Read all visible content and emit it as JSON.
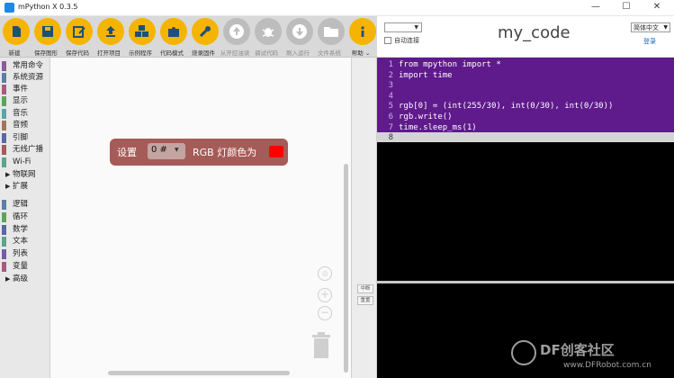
{
  "window": {
    "title": "mPython X 0.3.5",
    "controls": [
      "—",
      "☐",
      "✕"
    ]
  },
  "toolbar": {
    "items": [
      {
        "label": "新建",
        "icon": "new-file-icon",
        "active": true
      },
      {
        "label": "保存图形",
        "icon": "save-icon",
        "active": true
      },
      {
        "label": "保存代码",
        "icon": "edit-code-icon",
        "active": true
      },
      {
        "label": "打开项目",
        "icon": "upload-icon",
        "active": true
      },
      {
        "label": "示例程序",
        "icon": "cubes-icon",
        "active": true
      },
      {
        "label": "代码模式",
        "icon": "puzzle-icon",
        "active": true
      },
      {
        "label": "烧录固件",
        "icon": "wrench-icon",
        "active": true
      },
      {
        "label": "从开控油读",
        "icon": "upload-circle-icon",
        "active": false
      },
      {
        "label": "调试代码",
        "icon": "bug-icon",
        "active": false
      },
      {
        "label": "刷入运行",
        "icon": "download-circle-icon",
        "active": false
      },
      {
        "label": "文件系统",
        "icon": "folder-icon",
        "active": false
      },
      {
        "label": "帮助",
        "icon": "info-icon",
        "active": true
      }
    ],
    "help_suffix": "⌄"
  },
  "header": {
    "port_select_value": "",
    "auto_connect_label": "自动连接",
    "file_name": "my_code",
    "language": "简体中文",
    "login_label": "登录"
  },
  "categories": [
    {
      "label": "常用命令",
      "color": "#8e5a9e"
    },
    {
      "label": "系统资源",
      "color": "#5b80a5"
    },
    {
      "label": "事件",
      "color": "#a55b80"
    },
    {
      "label": "显示",
      "color": "#5ba55b"
    },
    {
      "label": "音乐",
      "color": "#5ba5a5"
    },
    {
      "label": "音频",
      "color": "#a5745b"
    },
    {
      "label": "引脚",
      "color": "#5b67a5"
    },
    {
      "label": "无线广播",
      "color": "#a55b5b"
    },
    {
      "label": "Wi-Fi",
      "color": "#5ba58c"
    },
    {
      "label": "物联网",
      "color": "",
      "expandable": true
    },
    {
      "label": "扩展",
      "color": "",
      "expandable": true
    },
    {
      "label": "逻辑",
      "color": "#5b80a5"
    },
    {
      "label": "循环",
      "color": "#5ba55b"
    },
    {
      "label": "数学",
      "color": "#5b67a5"
    },
    {
      "label": "文本",
      "color": "#5ba58c"
    },
    {
      "label": "列表",
      "color": "#745ba5"
    },
    {
      "label": "变量",
      "color": "#a55b80"
    },
    {
      "label": "高级",
      "color": "",
      "expandable": true
    }
  ],
  "block": {
    "set_label": "设置",
    "dropdown_value": "0 #",
    "rgb_label": "RGB 灯颜色为",
    "color_value": "#ff0000"
  },
  "divider": {
    "stop_label": "中断",
    "reset_label": "重置"
  },
  "editor": {
    "lines": [
      {
        "n": "1",
        "code": "from mpython import *"
      },
      {
        "n": "2",
        "code": "import time"
      },
      {
        "n": "3",
        "code": ""
      },
      {
        "n": "4",
        "code": ""
      },
      {
        "n": "5",
        "code": "rgb[0] = (int(255/30), int(0/30), int(0/30))"
      },
      {
        "n": "6",
        "code": "rgb.write()"
      },
      {
        "n": "7",
        "code": "time.sleep_ms(1)"
      },
      {
        "n": "8",
        "code": ""
      }
    ],
    "current_line": 8
  },
  "watermark": {
    "brand": "DF创客社区",
    "url": "www.DFRobot.com.cn"
  }
}
